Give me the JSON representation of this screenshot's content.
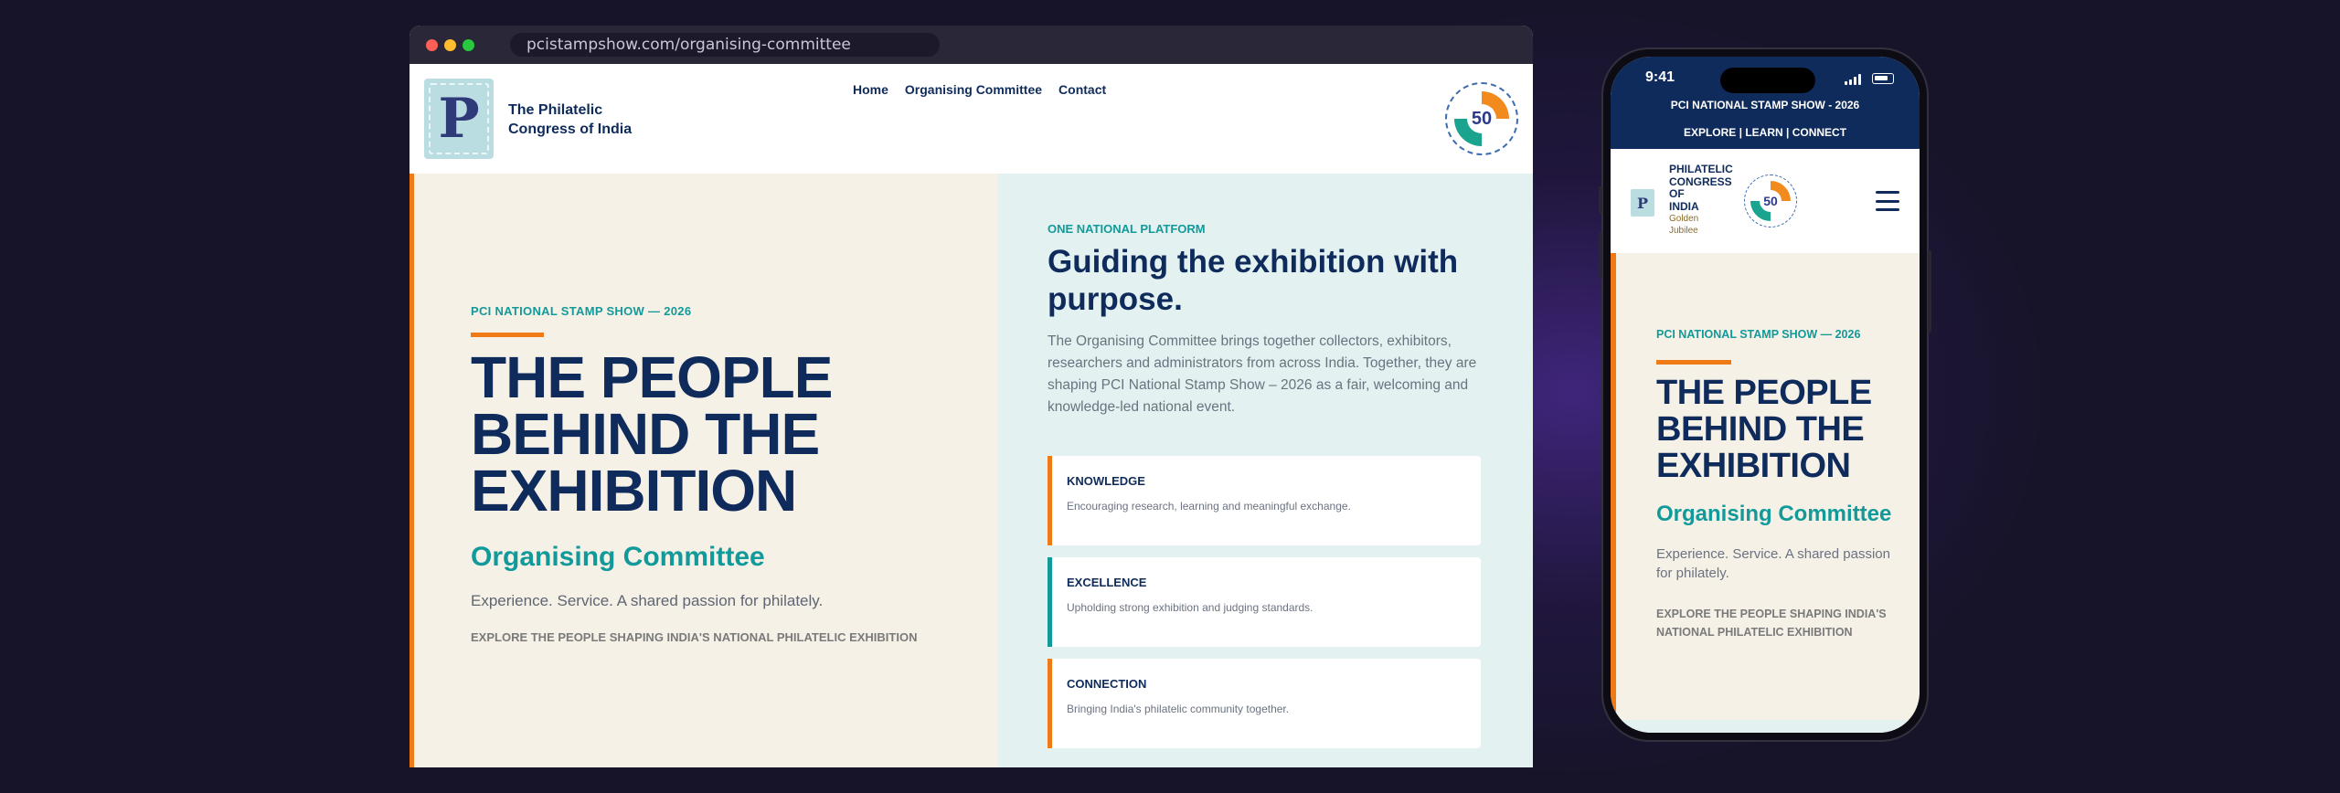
{
  "browser": {
    "url": "pcistampshow.com/organising-committee"
  },
  "site": {
    "brand_line1": "The Philatelic",
    "brand_line2": "Congress of India",
    "logo_glyph": "P",
    "emblem_glyph": "50",
    "nav": [
      {
        "label": "Home"
      },
      {
        "label": "Organising Committee"
      },
      {
        "label": "Contact"
      }
    ]
  },
  "hero": {
    "eyebrow": "PCI NATIONAL STAMP SHOW  —  2026",
    "title": "THE PEOPLE BEHIND THE EXHIBITION",
    "subtitle": "Organising Committee",
    "tagline": "Experience. Service. A shared passion for philately.",
    "cta": "EXPLORE THE PEOPLE SHAPING INDIA'S NATIONAL PHILATELIC EXHIBITION"
  },
  "platform": {
    "eyebrow": "ONE NATIONAL PLATFORM",
    "title": "Guiding the exhibition with purpose.",
    "body": "The Organising Committee brings together collectors, exhibitors, researchers and administrators from across India. Together, they are shaping PCI National Stamp Show – 2026 as a fair, welcoming and knowledge-led national event.",
    "cards": [
      {
        "title": "KNOWLEDGE",
        "desc": "Encouraging research, learning and meaningful exchange.",
        "color": "#f07a16"
      },
      {
        "title": "EXCELLENCE",
        "desc": "Upholding strong exhibition and judging standards.",
        "color": "#129a9a"
      },
      {
        "title": "CONNECTION",
        "desc": "Bringing India's philatelic community together.",
        "color": "#f07a16"
      }
    ]
  },
  "phone": {
    "time": "9:41",
    "topbar_line1": "PCI NATIONAL STAMP SHOW - 2026",
    "topbar_line2": "EXPLORE | LEARN | CONNECT",
    "brand_lines": [
      "PHILATELIC",
      "CONGRESS",
      "OF",
      "INDIA"
    ],
    "jubilee_lines": [
      "Golden",
      "Jubilee"
    ],
    "hero_title_lines": [
      "THE PEOPLE",
      "BEHIND THE",
      "EXHIBITION"
    ],
    "cta_lines": [
      "EXPLORE THE PEOPLE SHAPING INDIA'S",
      "NATIONAL PHILATELIC EXHIBITION"
    ]
  },
  "colors": {
    "navy": "#0f2b5b",
    "teal": "#129a9a",
    "orange": "#f07a16",
    "cream": "#f5f1e7",
    "mint": "#e3f2f1"
  }
}
